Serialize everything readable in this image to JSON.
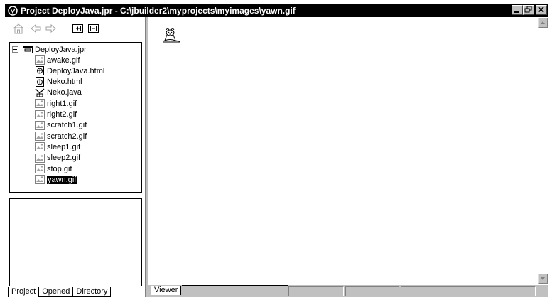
{
  "window": {
    "title": "Project DeployJava.jpr - C:\\jbuilder2\\myprojects\\myimages\\yawn.gif"
  },
  "toolbar": {
    "icons": [
      "home-icon",
      "back-arrow-icon",
      "forward-arrow-icon",
      "add-file-icon",
      "remove-file-icon"
    ]
  },
  "project_tree": {
    "root": "DeployJava.jpr",
    "items": [
      {
        "label": "awake.gif",
        "icon": "gif-image-icon"
      },
      {
        "label": "DeployJava.html",
        "icon": "html-file-icon"
      },
      {
        "label": "Neko.html",
        "icon": "html-file-icon"
      },
      {
        "label": "Neko.java",
        "icon": "java-file-icon"
      },
      {
        "label": "right1.gif",
        "icon": "gif-image-icon"
      },
      {
        "label": "right2.gif",
        "icon": "gif-image-icon"
      },
      {
        "label": "scratch1.gif",
        "icon": "gif-image-icon"
      },
      {
        "label": "scratch2.gif",
        "icon": "gif-image-icon"
      },
      {
        "label": "sleep1.gif",
        "icon": "gif-image-icon"
      },
      {
        "label": "sleep2.gif",
        "icon": "gif-image-icon"
      },
      {
        "label": "stop.gif",
        "icon": "gif-image-icon"
      },
      {
        "label": "yawn.gif",
        "icon": "gif-image-icon",
        "selected": true
      }
    ]
  },
  "left_tabs": [
    "Project",
    "Opened",
    "Directory"
  ],
  "right_tabs": [
    "Viewer"
  ],
  "colors": {
    "title_bar": "#000000",
    "selection": "#000000",
    "face": "#c0c0c0"
  }
}
